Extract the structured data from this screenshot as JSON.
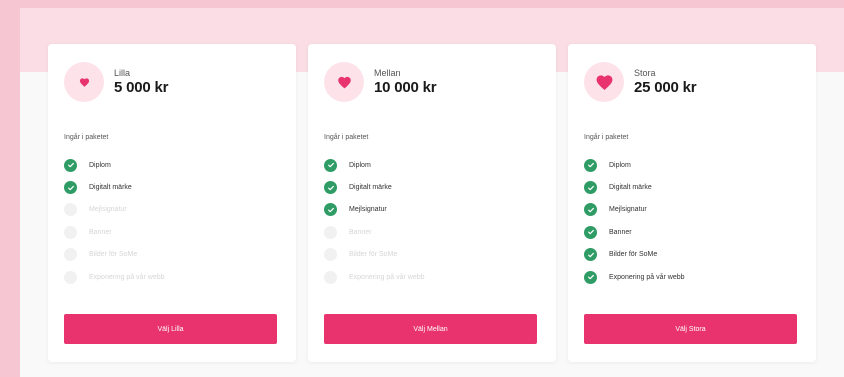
{
  "colors": {
    "page_background": "#f7c6d3",
    "panel_background": "#f9f9fa",
    "panel_band": "#fbdde6",
    "accent": "#e8336e",
    "heart_background": "#fde2ea",
    "check_on": "#2e9c64",
    "check_off": "#f1f1f2"
  },
  "plans": [
    {
      "name": "Lilla",
      "price": "5 000 kr",
      "included_label": "Ingår i paketet",
      "features": [
        {
          "label": "Diplom",
          "included": true
        },
        {
          "label": "Digitalt märke",
          "included": true
        },
        {
          "label": "Mejlsignatur",
          "included": false
        },
        {
          "label": "Banner",
          "included": false
        },
        {
          "label": "Bilder för SoMe",
          "included": false
        },
        {
          "label": "Exponering på vår webb",
          "included": false
        }
      ],
      "button_label": "Välj Lilla"
    },
    {
      "name": "Mellan",
      "price": "10 000 kr",
      "included_label": "Ingår i paketet",
      "features": [
        {
          "label": "Diplom",
          "included": true
        },
        {
          "label": "Digitalt märke",
          "included": true
        },
        {
          "label": "Mejlsignatur",
          "included": true
        },
        {
          "label": "Banner",
          "included": false
        },
        {
          "label": "Bilder för SoMe",
          "included": false
        },
        {
          "label": "Exponering på vår webb",
          "included": false
        }
      ],
      "button_label": "Välj Mellan"
    },
    {
      "name": "Stora",
      "price": "25 000 kr",
      "included_label": "Ingår i paketet",
      "features": [
        {
          "label": "Diplom",
          "included": true
        },
        {
          "label": "Digitalt märke",
          "included": true
        },
        {
          "label": "Mejlsignatur",
          "included": true
        },
        {
          "label": "Banner",
          "included": true
        },
        {
          "label": "Bilder för SoMe",
          "included": true
        },
        {
          "label": "Exponering på vår webb",
          "included": true
        }
      ],
      "button_label": "Välj Stora"
    }
  ]
}
